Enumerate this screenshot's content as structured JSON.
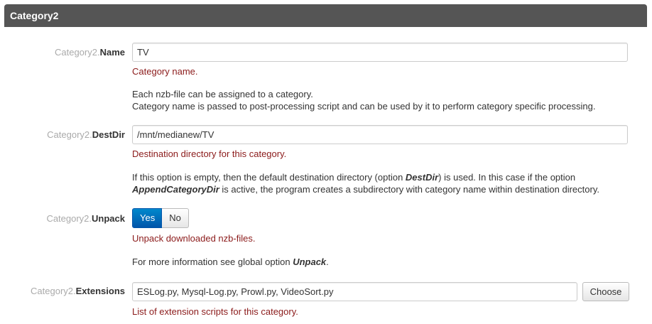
{
  "section": {
    "title": "Category2"
  },
  "prefix": "Category2.",
  "fields": {
    "name": {
      "key": "Name",
      "value": "TV",
      "hint": "Category name.",
      "desc_line1": "Each nzb-file can be assigned to a category.",
      "desc_line2": "Category name is passed to post-processing script and can be used by it to perform category specific processing."
    },
    "destdir": {
      "key": "DestDir",
      "value": "/mnt/medianew/TV",
      "hint": "Destination directory for this category.",
      "desc_a": "If this option is empty, then the default destination directory (option ",
      "desc_b": "DestDir",
      "desc_c": ") is used. In this case if the option",
      "desc_d": "AppendCategoryDir",
      "desc_e": " is active, the program creates a subdirectory with category name within destination directory."
    },
    "unpack": {
      "key": "Unpack",
      "yes_label": "Yes",
      "no_label": "No",
      "selected": "Yes",
      "hint": "Unpack downloaded nzb-files.",
      "desc_a": "For more information see global option ",
      "desc_b": "Unpack",
      "desc_c": "."
    },
    "extensions": {
      "key": "Extensions",
      "value": "ESLog.py, Mysql-Log.py, Prowl.py, VideoSort.py",
      "choose_label": "Choose",
      "hint": "List of extension scripts for this category."
    }
  },
  "colors": {
    "header_bg": "#555555",
    "hint_red": "#8b1a1a",
    "toggle_active": "#0066bb"
  }
}
